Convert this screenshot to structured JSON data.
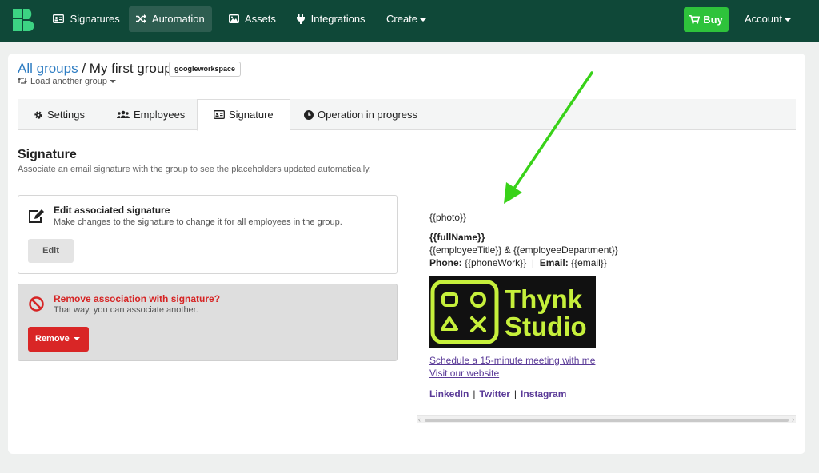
{
  "nav": {
    "items": [
      {
        "label": "Signatures",
        "icon": "id-card-icon"
      },
      {
        "label": "Automation",
        "icon": "shuffle-icon"
      },
      {
        "label": "Assets",
        "icon": "image-icon"
      },
      {
        "label": "Integrations",
        "icon": "plug-icon"
      },
      {
        "label": "Create",
        "icon": ""
      }
    ],
    "buy_label": "Buy",
    "account_label": "Account"
  },
  "header": {
    "breadcrumb_root": "All groups",
    "breadcrumb_sep": " / ",
    "group_name": "My first group",
    "badge": "googleworkspace",
    "load_another": "Load another group"
  },
  "tabs": [
    {
      "label": "Settings",
      "icon": "gear-icon"
    },
    {
      "label": "Employees",
      "icon": "users-icon"
    },
    {
      "label": "Signature",
      "icon": "id-card-icon",
      "active": true
    },
    {
      "label": "Operation in progress",
      "icon": "clock-icon"
    }
  ],
  "section": {
    "title": "Signature",
    "description": "Associate an email signature with the group to see the placeholders updated automatically."
  },
  "edit_panel": {
    "title": "Edit associated signature",
    "description": "Make changes to the signature to change it for all employees in the group.",
    "button": "Edit"
  },
  "remove_panel": {
    "title": "Remove association with signature?",
    "description": "That way, you can associate another.",
    "button": "Remove"
  },
  "signature_preview": {
    "photo": "{{photo}}",
    "full_name": "{{fullName}}",
    "title_line": "{{employeeTitle}} & {{employeeDepartment}}",
    "phone_label": "Phone:",
    "phone_value": "{{phoneWork}}",
    "email_label": "Email:",
    "email_value": "{{email}}",
    "banner_text_1": "Thynk",
    "banner_text_2": "Studio",
    "link_meeting": "Schedule a 15-minute meeting with me",
    "link_website": "Visit our website",
    "social": [
      "LinkedIn",
      "Twitter",
      "Instagram"
    ]
  },
  "colors": {
    "topbar": "#0f4838",
    "buy": "#2ec33b",
    "link": "#2d7cc2",
    "danger": "#d92626",
    "banner_accent": "#c6f03b",
    "annotation_arrow": "#39d219"
  }
}
